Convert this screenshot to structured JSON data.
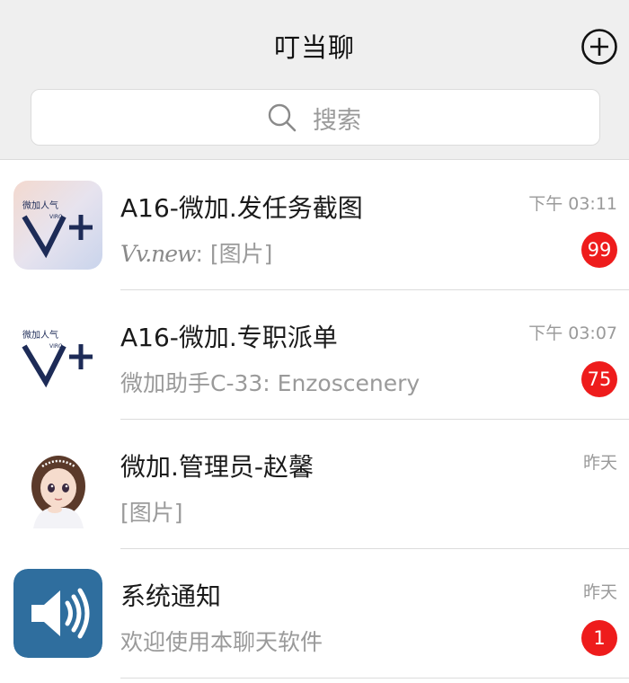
{
  "header": {
    "title": "叮当聊",
    "add_icon": "plus-circle-icon"
  },
  "search": {
    "icon": "search-icon",
    "placeholder": "搜索"
  },
  "accent": {
    "badge": "#ee1c1c",
    "speaker_bg": "#2f6e9e"
  },
  "chats": [
    {
      "name": "A16-微加.发任务截图",
      "sender": "Vv.new",
      "preview": ": [图片]",
      "time": "下午 03:11",
      "unread": "99",
      "avatar": {
        "logo_text": "微加人气",
        "logo_sub": "VIRO",
        "logo_mark": "V+"
      }
    },
    {
      "name": "A16-微加.专职派单",
      "preview": "微加助手C-33: Enzoscenery",
      "time": "下午 03:07",
      "unread": "75",
      "avatar": {
        "logo_text": "微加人气",
        "logo_sub": "VIRO",
        "logo_mark": "V+"
      }
    },
    {
      "name": "微加.管理员-赵馨",
      "preview": "[图片]",
      "time": "昨天",
      "unread": "",
      "avatar": {
        "icon": "girl-portrait-icon"
      }
    },
    {
      "name": "系统通知",
      "preview": "欢迎使用本聊天软件",
      "time": "昨天",
      "unread": "1",
      "avatar": {
        "icon": "speaker-icon"
      }
    }
  ]
}
